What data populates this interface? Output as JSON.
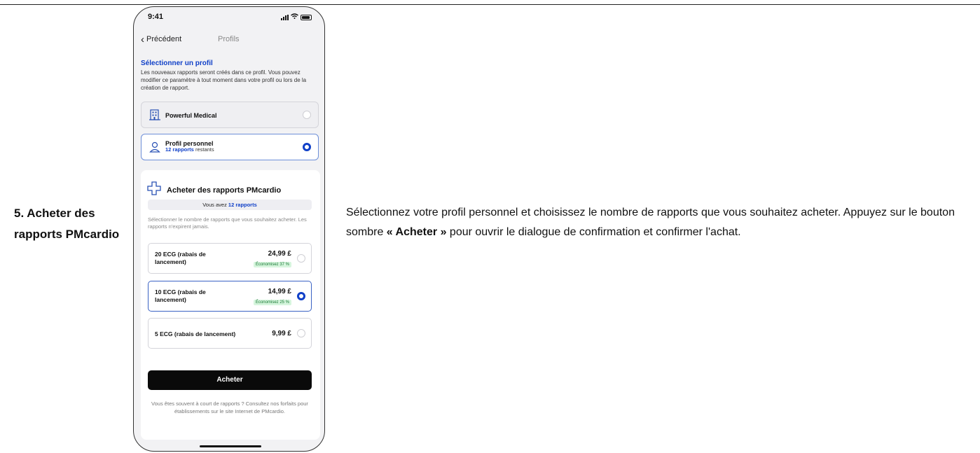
{
  "step": {
    "title": "5. Acheter des rapports PMcardio",
    "description_before": "Sélectionnez votre profil personnel et choisissez le nombre de rapports que vous souhaitez acheter. Appuyez sur le bouton sombre ",
    "description_bold": "« Acheter »",
    "description_after": " pour ouvrir le dialogue de confirmation et confirmer l'achat."
  },
  "phone": {
    "status_time": "9:41",
    "nav": {
      "back_label": "Précédent",
      "title": "Profils"
    },
    "section": {
      "title": "Sélectionner un profil",
      "subtitle": "Les nouveaux rapports seront créés dans ce profil. Vous pouvez modifier ce paramètre à tout moment dans votre profil ou lors de la création de rapport."
    },
    "profiles": [
      {
        "name": "Powerful Medical",
        "icon": "building-icon",
        "selected": false
      },
      {
        "name": "Profil personnel",
        "remaining_count": "12 rapports",
        "remaining_suffix": " restants",
        "icon": "user-icon",
        "selected": true
      }
    ],
    "purchase": {
      "title": "Acheter des rapports PMcardio",
      "icon": "medical-cross-icon",
      "balance_prefix": "Vous avez ",
      "balance_value": "12 rapports",
      "subtitle": "Sélectionner le nombre de rapports que vous souhaitez acheter. Les rapports n'expirent jamais.",
      "offers": [
        {
          "label": "20 ECG (rabais de lancement)",
          "price": "24,99 £",
          "savings": "Économisez 37 %",
          "selected": false
        },
        {
          "label": "10 ECG (rabais de lancement)",
          "price": "14,99 £",
          "savings": "Économisez 25 %",
          "selected": true
        },
        {
          "label": "5 ECG (rabais de lancement)",
          "price": "9,99 £",
          "savings": "",
          "selected": false
        }
      ],
      "button_label": "Acheter",
      "footer": "Vous êtes souvent à court de rapports ? Consultez nos forfaits pour établissements sur le site Internet de PMcardio."
    }
  },
  "colors": {
    "accent": "#1040c8",
    "savings_bg": "#d6f5dd",
    "savings_text": "#1a7a35"
  }
}
